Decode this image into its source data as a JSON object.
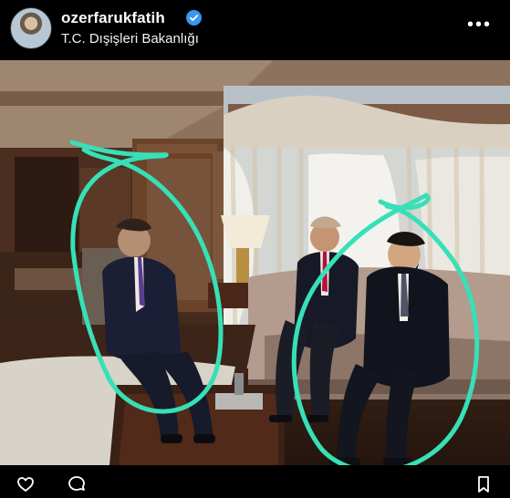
{
  "header": {
    "username": "ozerfarukfatih",
    "location": "T.C. Dışişleri Bakanlığı",
    "more_label": "•••",
    "verified_icon": "verified-badge-icon"
  },
  "post": {
    "image_icon": "photo",
    "highlight_color": "#37e0b7",
    "tag_icon": "user-tag-icon"
  },
  "bottom_bar": {
    "icons": [
      "heart-icon",
      "comment-icon",
      "bookmark-icon"
    ]
  }
}
